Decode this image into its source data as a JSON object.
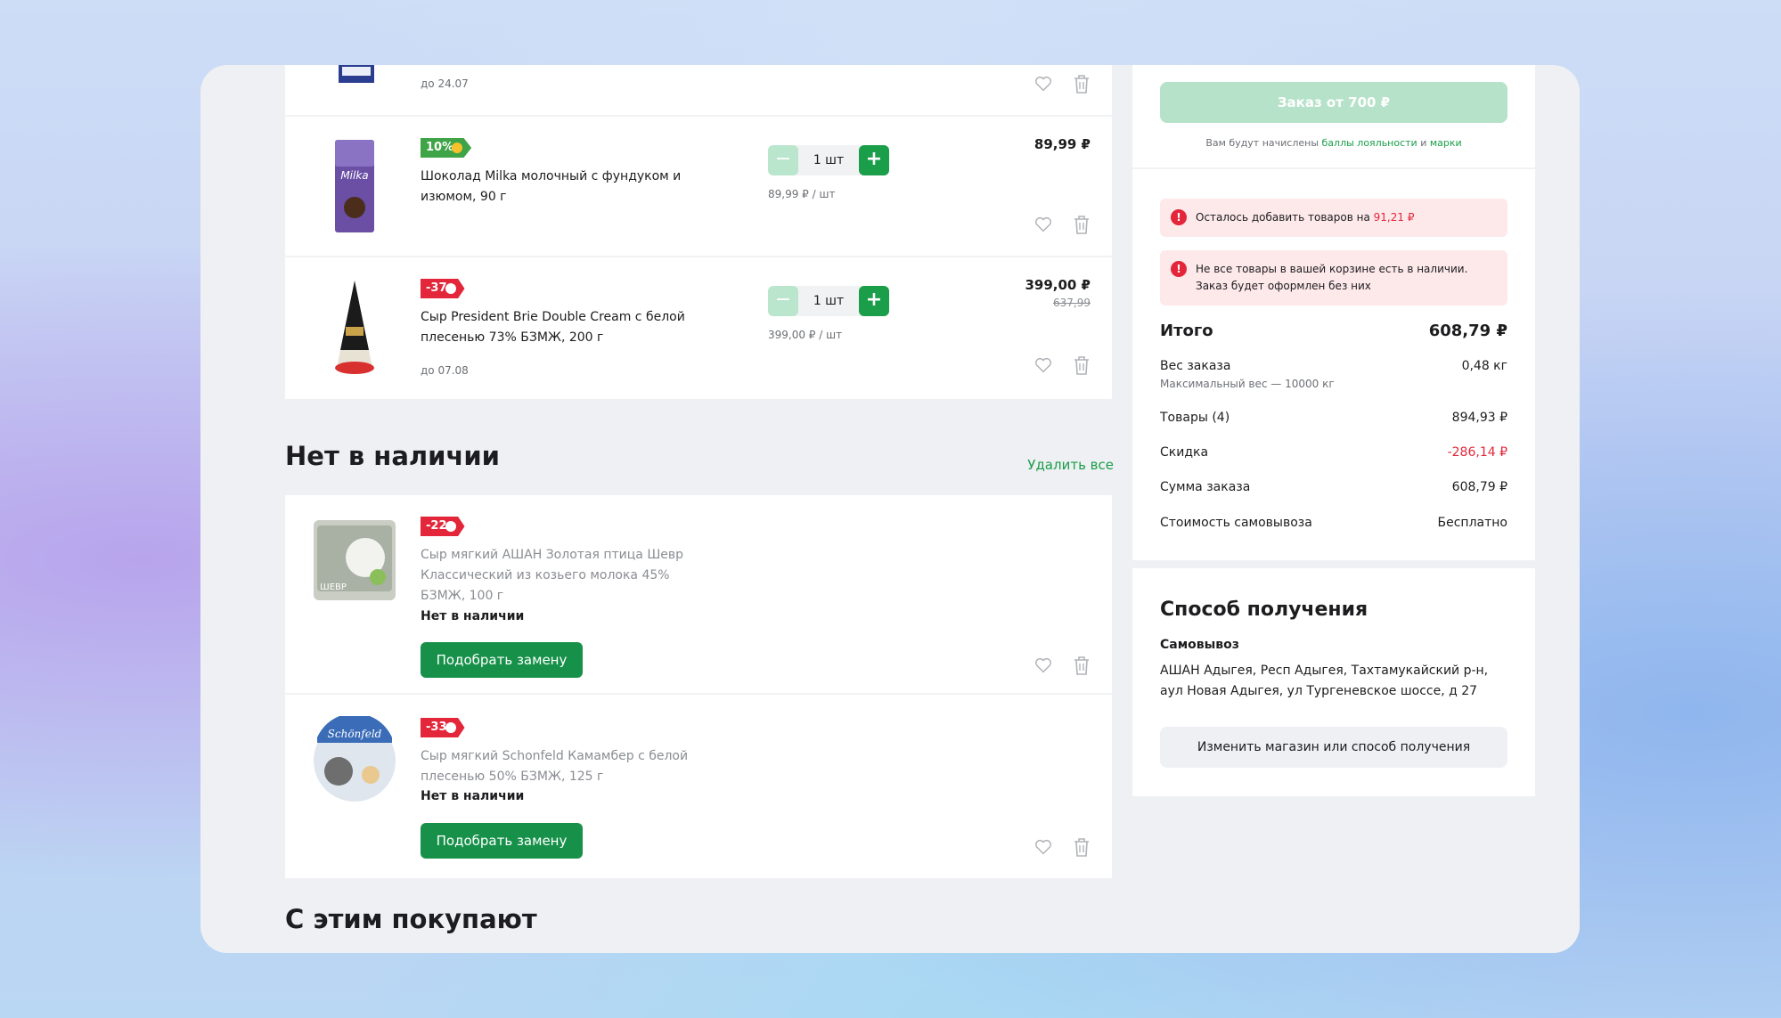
{
  "cart": {
    "items": [
      {
        "date": "до 24.07"
      },
      {
        "badge": "10%",
        "name": "Шоколад Milka молочный с фундуком и изюмом, 90 г",
        "qty": "1 шт",
        "unit_price": "89,99 ₽ / шт",
        "price": "89,99 ₽"
      },
      {
        "badge": "-37",
        "name": "Сыр President Brie Double Cream с белой плесенью 73% БЗМЖ, 200 г",
        "qty": "1 шт",
        "unit_price": "399,00 ₽ / шт",
        "price": "399,00 ₽",
        "old_price": "637,99",
        "date": "до 07.08"
      }
    ]
  },
  "out_of_stock": {
    "title": "Нет в наличии",
    "delete_all": "Удалить все",
    "items": [
      {
        "badge": "-22",
        "name": "Сыр мягкий АШАН Золотая птица Шевр Классический из козьего молока 45% БЗМЖ, 100 г",
        "status": "Нет в наличии",
        "button": "Подобрать замену",
        "thumb_label": "ШЕВР"
      },
      {
        "badge": "-33",
        "name": "Сыр мягкий Schonfeld Камамбер с белой плесенью 50% БЗМЖ, 125 г",
        "status": "Нет в наличии",
        "button": "Подобрать замену",
        "thumb_label": "Schönfeld"
      }
    ]
  },
  "related": {
    "title": "С этим покупают"
  },
  "summary": {
    "order_button": "Заказ от 700 ₽",
    "loyalty_prefix": "Вам будут начислены",
    "loyalty_link1": "баллы лояльности",
    "loyalty_and": "и",
    "loyalty_link2": "марки",
    "alert1_text": "Осталось добавить товаров на",
    "alert1_amount": "91,21 ₽",
    "alert2_text": "Не все товары в вашей корзине есть в наличии. Заказ будет оформлен без них",
    "total_label": "Итого",
    "total_value": "608,79 ₽",
    "weight_label": "Вес заказа",
    "weight_value": "0,48 кг",
    "weight_note": "Максимальный вес — 10000 кг",
    "goods_label": "Товары (4)",
    "goods_value": "894,93 ₽",
    "discount_label": "Скидка",
    "discount_value": "-286,14 ₽",
    "sum_label": "Сумма заказа",
    "sum_value": "608,79 ₽",
    "pickup_label": "Стоимость самовывоза",
    "pickup_value": "Бесплатно"
  },
  "delivery": {
    "title": "Способ получения",
    "method": "Самовывоз",
    "address": "АШАН Адыгея, Респ Адыгея, Тахтамукайский р-н, аул Новая Адыгея, ул Тургеневское шоссе, д 27",
    "change_button": "Изменить магазин или способ получения"
  },
  "colors": {
    "accent_green": "#1a9e49",
    "alert_red": "#e3263a"
  }
}
